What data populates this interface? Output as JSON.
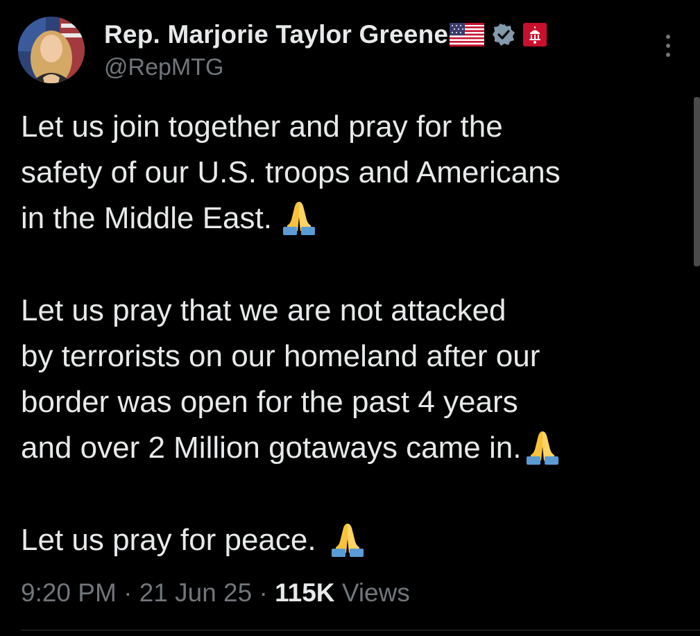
{
  "author": {
    "display_name": "Rep. Marjorie Taylor Greene",
    "handle": "@RepMTG",
    "badges": [
      "us-flag-icon",
      "verified-icon",
      "government-icon"
    ]
  },
  "tweet": {
    "lines": [
      "Let us join together and pray for the",
      "safety of our U.S. troops and Americans",
      "in the Middle East.",
      "",
      "Let us pray that we are not attacked",
      "by terrorists on our homeland after our",
      "border was open for the past 4 years",
      "and over 2 Million gotaways came in.",
      "",
      "Let us pray for peace."
    ]
  },
  "meta": {
    "time": "9:20 PM",
    "separator": "·",
    "date": "21 Jun 25",
    "views_count": "115K",
    "views_label": "Views"
  },
  "colors": {
    "background": "#000000",
    "text": "#e7e9ea",
    "secondary": "#71767b",
    "verified": "#829aab"
  }
}
